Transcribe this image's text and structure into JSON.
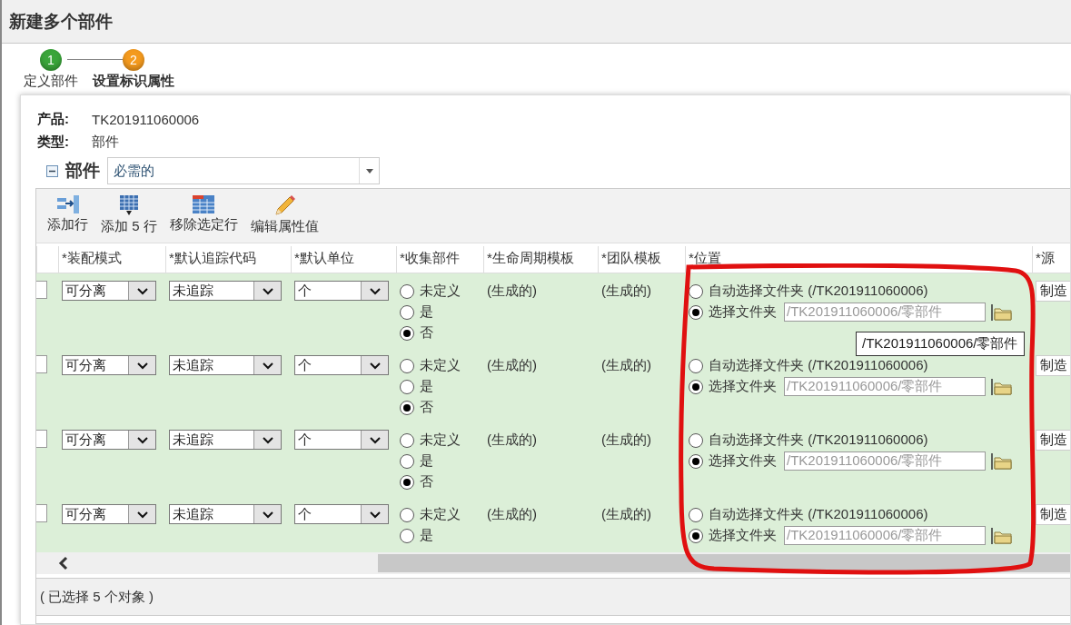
{
  "title": "新建多个部件",
  "steps": [
    {
      "number": "1",
      "label": "定义部件",
      "current": false
    },
    {
      "number": "2",
      "label": "设置标识属性",
      "current": true
    }
  ],
  "info": [
    {
      "label": "产品:",
      "value": "TK201911060006"
    },
    {
      "label": "类型:",
      "value": "部件"
    }
  ],
  "section": {
    "title": "部件",
    "expanded": true,
    "filter": "必需的"
  },
  "toolbar": [
    {
      "kind": "add-row",
      "label": "添加行"
    },
    {
      "kind": "add-five",
      "label": "添加 5 行"
    },
    {
      "kind": "remove",
      "label": "移除选定行"
    },
    {
      "kind": "edit",
      "label": "编辑属性值"
    }
  ],
  "table": {
    "columns": [
      "*装配模式",
      "*默认追踪代码",
      "*默认单位",
      "*收集部件",
      "*生命周期模板",
      "*团队模板",
      "*位置",
      "*源"
    ],
    "rows": [
      {
        "checked": false,
        "assembly_mode": "可分离",
        "trace_code": "未追踪",
        "unit": "个",
        "collect": [
          {
            "label": "未定义",
            "selected": false
          },
          {
            "label": "是",
            "selected": false
          },
          {
            "label": "否",
            "selected": true
          }
        ],
        "lifecycle": "(生成的)",
        "team": "(生成的)",
        "location_auto": {
          "label": "自动选择文件夹 (/TK201911060006)",
          "selected": false
        },
        "location_choose": {
          "label": "选择文件夹",
          "selected": true,
          "value": "/TK201911060006/零部件",
          "disabled": true
        },
        "source": "制造",
        "tooltip": "/TK201911060006/零部件"
      },
      {
        "checked": false,
        "assembly_mode": "可分离",
        "trace_code": "未追踪",
        "unit": "个",
        "collect": [
          {
            "label": "未定义",
            "selected": false
          },
          {
            "label": "是",
            "selected": false
          },
          {
            "label": "否",
            "selected": true
          }
        ],
        "lifecycle": "(生成的)",
        "team": "(生成的)",
        "location_auto": {
          "label": "自动选择文件夹 (/TK201911060006)",
          "selected": false
        },
        "location_choose": {
          "label": "选择文件夹",
          "selected": true,
          "value": "/TK201911060006/零部件",
          "disabled": true
        },
        "source": "制造"
      },
      {
        "checked": false,
        "assembly_mode": "可分离",
        "trace_code": "未追踪",
        "unit": "个",
        "collect": [
          {
            "label": "未定义",
            "selected": false
          },
          {
            "label": "是",
            "selected": false
          },
          {
            "label": "否",
            "selected": true
          }
        ],
        "lifecycle": "(生成的)",
        "team": "(生成的)",
        "location_auto": {
          "label": "自动选择文件夹 (/TK201911060006)",
          "selected": false
        },
        "location_choose": {
          "label": "选择文件夹",
          "selected": true,
          "value": "/TK201911060006/零部件",
          "disabled": true
        },
        "source": "制造"
      },
      {
        "checked": false,
        "assembly_mode": "可分离",
        "trace_code": "未追踪",
        "unit": "个",
        "collect": [
          {
            "label": "未定义",
            "selected": false
          },
          {
            "label": "是",
            "selected": false
          }
        ],
        "lifecycle": "(生成的)",
        "team": "(生成的)",
        "location_auto": {
          "label": "自动选择文件夹 (/TK201911060006)",
          "selected": false
        },
        "location_choose": {
          "label": "选择文件夹",
          "selected": true,
          "value": "/TK201911060006/零部件",
          "disabled": true
        },
        "source": "制造"
      }
    ]
  },
  "status": "( 已选择 5 个对象 )"
}
